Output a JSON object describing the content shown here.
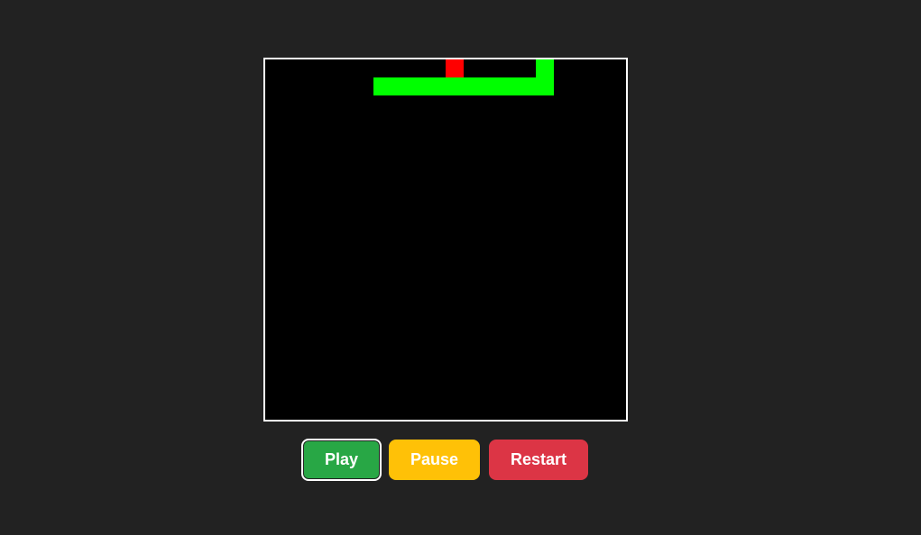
{
  "game": {
    "grid_size": 20,
    "snake_color": "#00ff00",
    "food_color": "#ff0000",
    "board_background": "#000000",
    "board_border_color": "#ffffff",
    "snake": [
      {
        "col": 15,
        "row": 0
      },
      {
        "col": 15,
        "row": 1
      },
      {
        "col": 14,
        "row": 1
      },
      {
        "col": 13,
        "row": 1
      },
      {
        "col": 12,
        "row": 1
      },
      {
        "col": 11,
        "row": 1
      },
      {
        "col": 10,
        "row": 1
      },
      {
        "col": 9,
        "row": 1
      },
      {
        "col": 8,
        "row": 1
      },
      {
        "col": 7,
        "row": 1
      },
      {
        "col": 6,
        "row": 1
      }
    ],
    "food": {
      "col": 10,
      "row": 0
    }
  },
  "controls": {
    "play_label": "Play",
    "play_color": "#28a745",
    "pause_label": "Pause",
    "pause_color": "#ffc107",
    "restart_label": "Restart",
    "restart_color": "#dc3545",
    "focused": "play"
  }
}
